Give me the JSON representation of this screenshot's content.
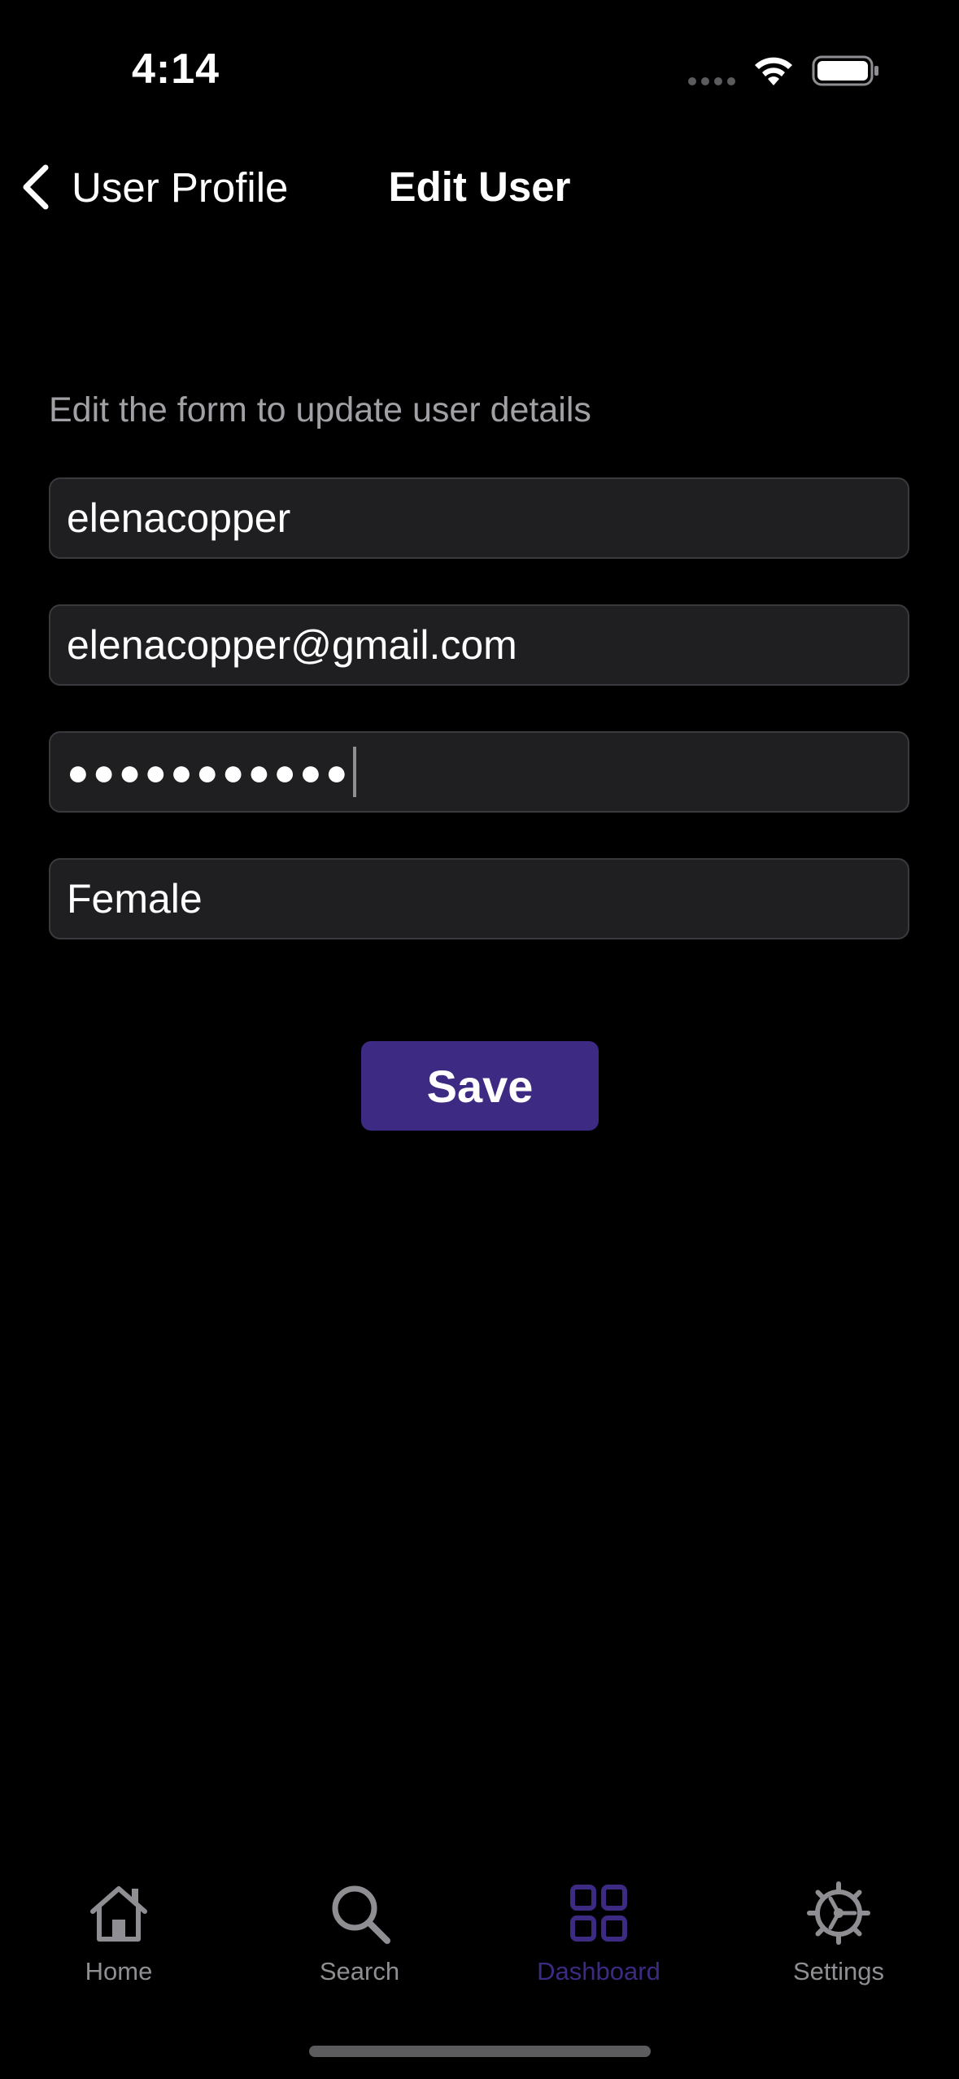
{
  "status_bar": {
    "time": "4:14"
  },
  "nav": {
    "back_label": "User Profile",
    "title": "Edit User"
  },
  "form": {
    "subtitle": "Edit the form to update user details",
    "username_value": "elenacopper",
    "email_value": "elenacopper@gmail.com",
    "password_masked": "●●●●●●●●●●●",
    "gender_value": "Female",
    "save_label": "Save"
  },
  "tabs": [
    {
      "label": "Home",
      "icon": "house-icon",
      "active": false
    },
    {
      "label": "Search",
      "icon": "magnifier-icon",
      "active": false
    },
    {
      "label": "Dashboard",
      "icon": "grid-icon",
      "active": true
    },
    {
      "label": "Settings",
      "icon": "gear-icon",
      "active": false
    }
  ],
  "colors": {
    "background": "#000000",
    "accent": "#3d2a82",
    "field_background": "#1f1f22",
    "inactive_tab": "#8e8e93",
    "subtitle_text": "#a0a0a5"
  }
}
